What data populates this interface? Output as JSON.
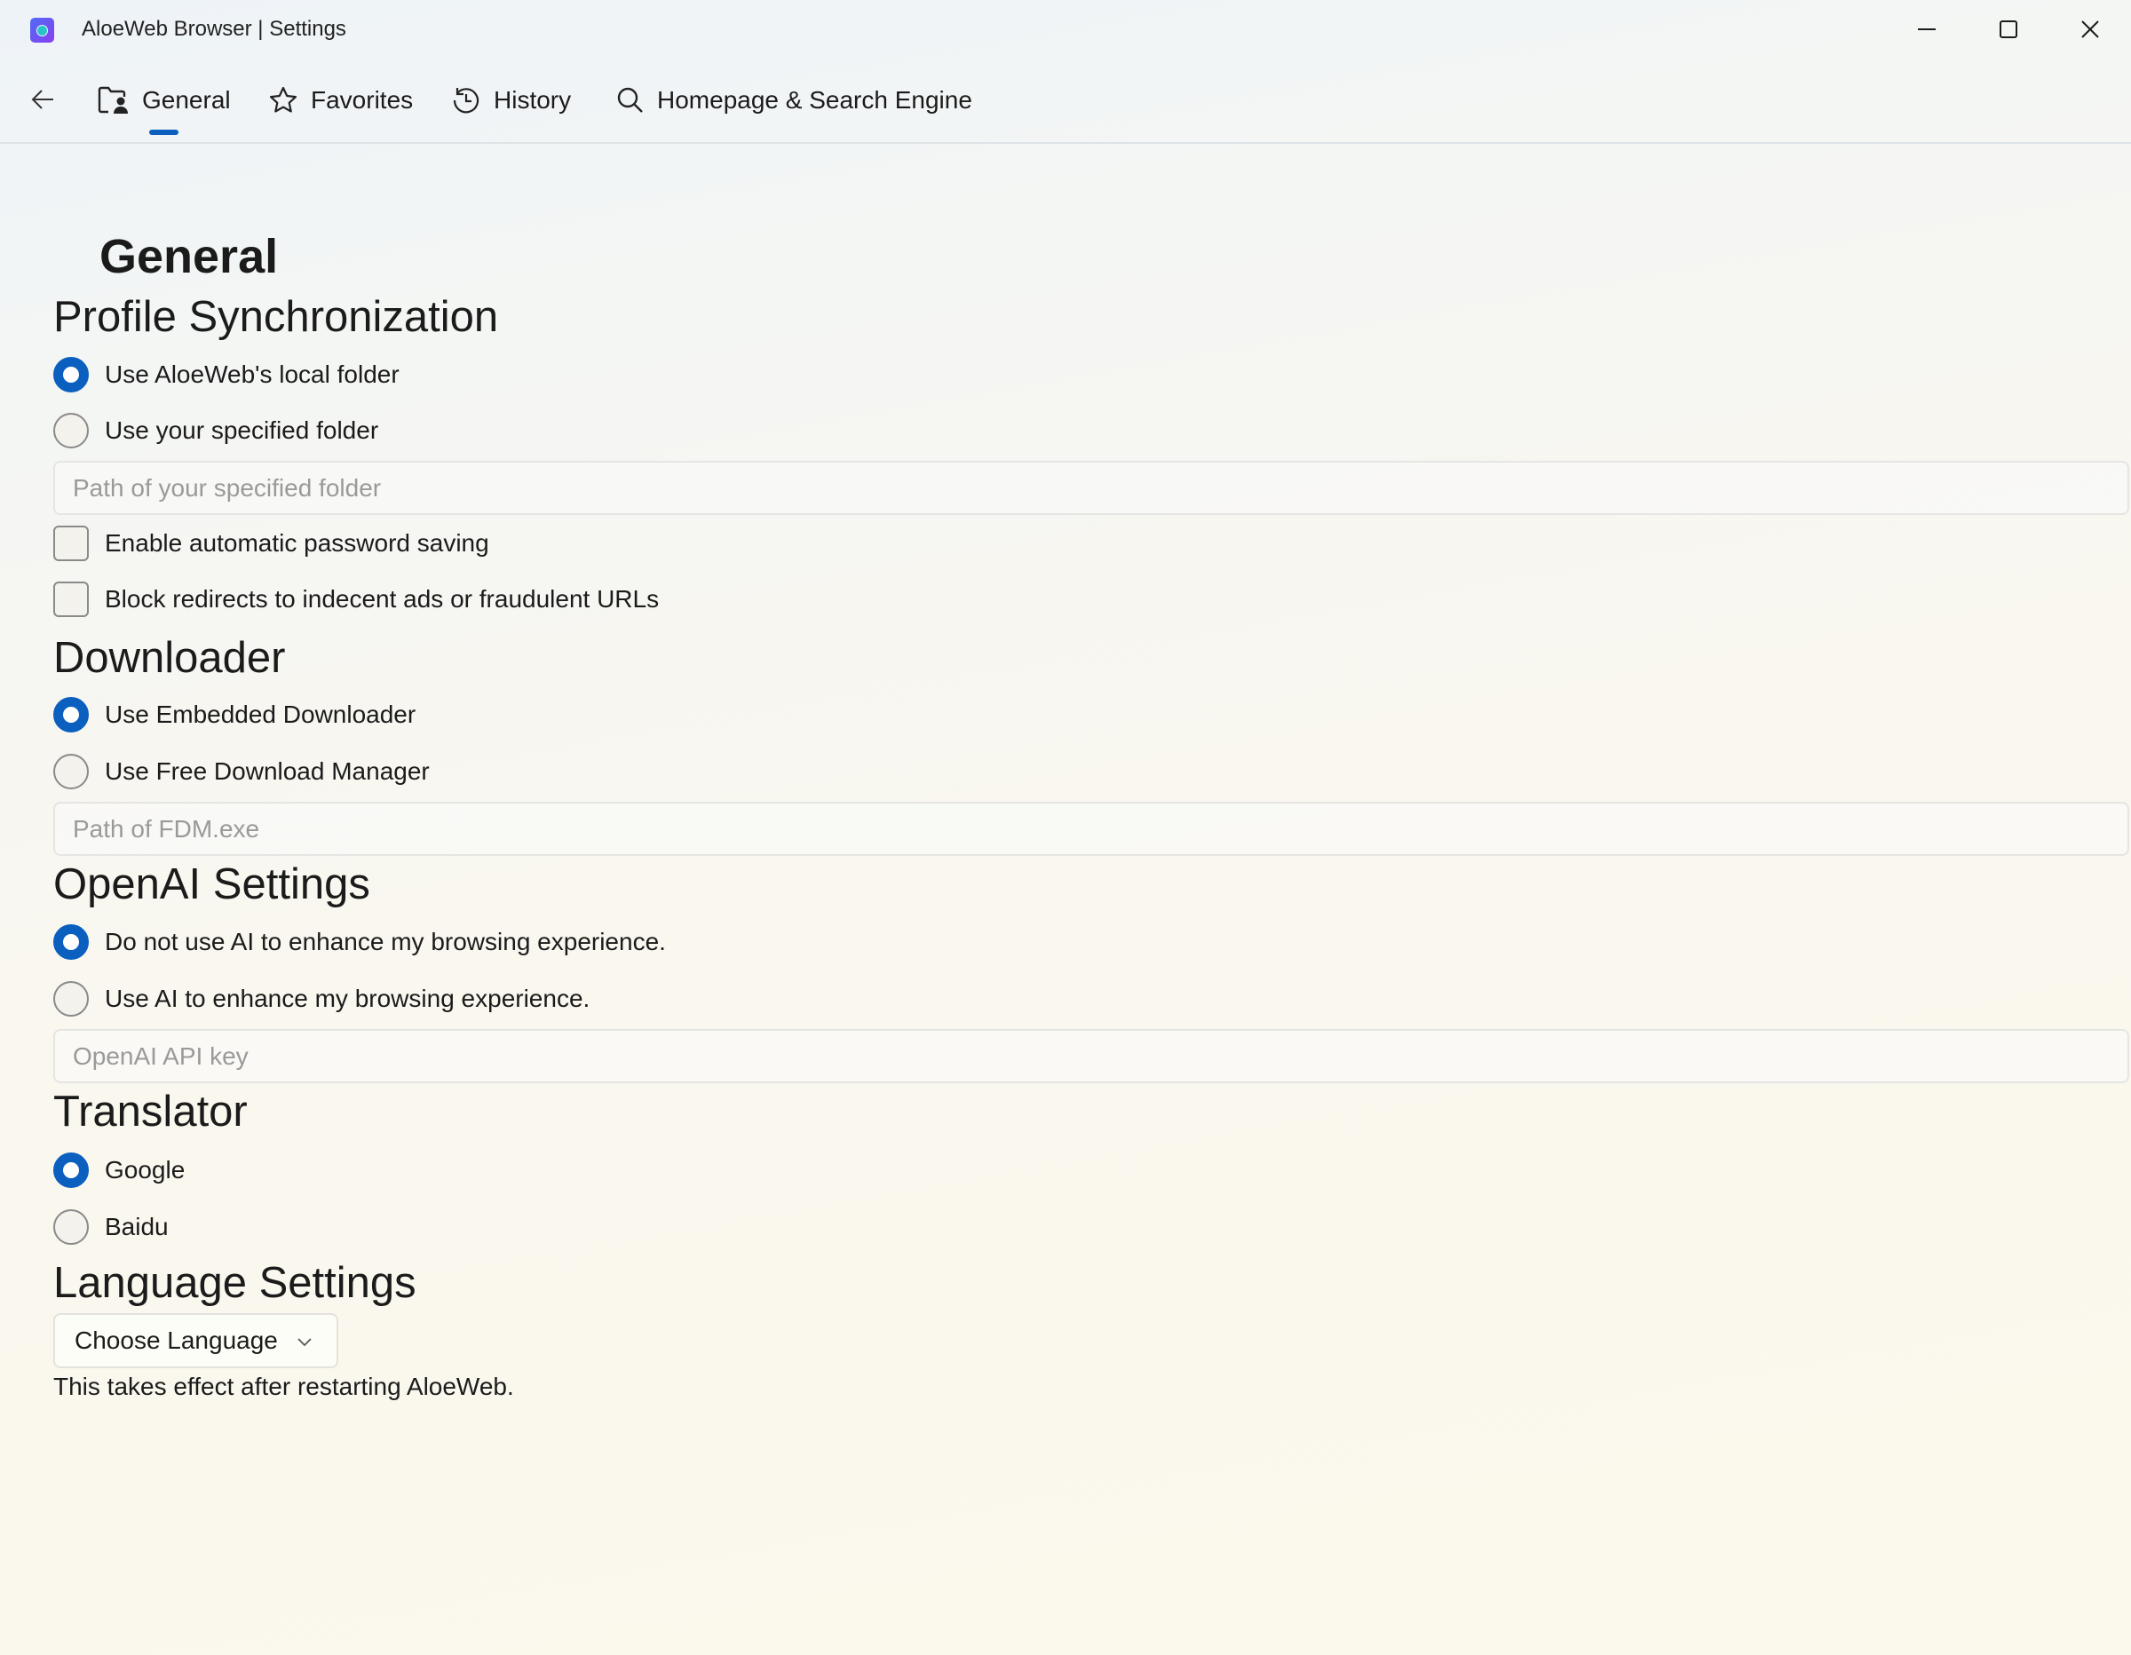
{
  "window": {
    "title": "AloeWeb Browser | Settings",
    "icon": "aloeweb-globe-icon",
    "controls": [
      "minimize-icon",
      "maximize-icon",
      "close-icon"
    ]
  },
  "nav": {
    "back_icon": "back-arrow-icon",
    "tabs": [
      {
        "label": "General",
        "icon": "folder-person-icon",
        "active": true
      },
      {
        "label": "Favorites",
        "icon": "star-icon",
        "active": false
      },
      {
        "label": "History",
        "icon": "history-clock-icon",
        "active": false
      },
      {
        "label": "Homepage & Search Engine",
        "icon": "search-icon",
        "active": false
      }
    ]
  },
  "page": {
    "title": "General",
    "sections": {
      "profile": {
        "heading": "Profile Synchronization",
        "options": [
          {
            "label": "Use AloeWeb's local folder",
            "selected": true
          },
          {
            "label": "Use your specified folder",
            "selected": false
          }
        ],
        "path_placeholder": "Path of your specified folder",
        "path_value": "",
        "checkboxes": [
          {
            "label": "Enable automatic password saving",
            "checked": false
          },
          {
            "label": "Block redirects to indecent ads or fraudulent URLs",
            "checked": false
          }
        ]
      },
      "downloader": {
        "heading": "Downloader",
        "options": [
          {
            "label": "Use Embedded Downloader",
            "selected": true
          },
          {
            "label": "Use Free Download Manager",
            "selected": false
          }
        ],
        "path_placeholder": "Path of FDM.exe",
        "path_value": ""
      },
      "openai": {
        "heading": "OpenAI Settings",
        "options": [
          {
            "label": "Do not use AI to enhance my browsing experience.",
            "selected": true
          },
          {
            "label": "Use AI to enhance my browsing experience.",
            "selected": false
          }
        ],
        "key_placeholder": "OpenAI API key",
        "key_value": ""
      },
      "translator": {
        "heading": "Translator",
        "options": [
          {
            "label": "Google",
            "selected": true
          },
          {
            "label": "Baidu",
            "selected": false
          }
        ]
      },
      "language": {
        "heading": "Language Settings",
        "dropdown_label": "Choose Language",
        "note": "This takes effect after restarting AloeWeb."
      }
    }
  },
  "colors": {
    "accent": "#0a5fbf"
  }
}
